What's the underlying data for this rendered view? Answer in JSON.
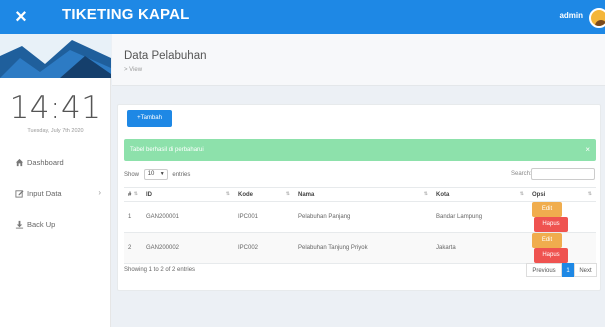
{
  "header": {
    "title": "TIKETING KAPAL",
    "close_icon": "close-icon",
    "user": "admin"
  },
  "sidebar": {
    "clock": "14:41",
    "date": "Tuesday, July 7th 2020",
    "items": [
      {
        "label": "Dashboard",
        "icon": "home-icon"
      },
      {
        "label": "Input Data",
        "icon": "edit-icon",
        "chevron": "›"
      },
      {
        "label": "Back Up",
        "icon": "download-icon"
      }
    ]
  },
  "page": {
    "title": "Data Pelabuhan",
    "breadcrumb": "> View"
  },
  "toolbar": {
    "add_label": "+Tambah"
  },
  "alert": {
    "message": "Tabel berhasil di perbaharui",
    "close": "×"
  },
  "table_controls": {
    "show_label": "Show",
    "length_value": "10",
    "entries_label": "entries",
    "search_label": "Search:",
    "search_value": ""
  },
  "table": {
    "columns": [
      "#",
      "ID",
      "Kode",
      "Nama",
      "Kota",
      "Opsi"
    ],
    "rows": [
      {
        "no": "1",
        "id": "GAN200001",
        "kode": "IPC001",
        "nama": "Pelabuhan Panjang",
        "kota": "Bandar Lampung"
      },
      {
        "no": "2",
        "id": "GAN200002",
        "kode": "IPC002",
        "nama": "Pelabuhan Tanjung Priyok",
        "kota": "Jakarta"
      }
    ],
    "edit_label": "Edit",
    "delete_label": "Hapus"
  },
  "footer": {
    "info": "Showing 1 to 2 of 2 entries",
    "prev": "Previous",
    "page": "1",
    "next": "Next"
  },
  "colors": {
    "primary": "#1e88e5",
    "success_alert": "#8de1ab",
    "edit": "#f0ad4e",
    "delete": "#ef5350"
  }
}
